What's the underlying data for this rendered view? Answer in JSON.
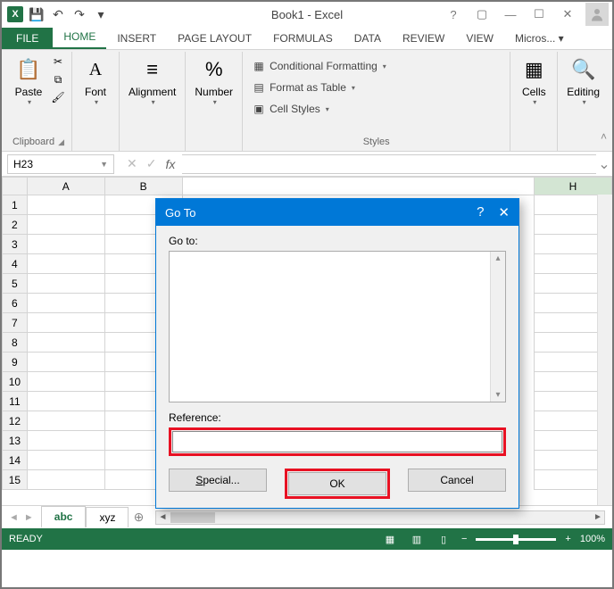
{
  "title": "Book1 - Excel",
  "qat": {
    "save": "💾",
    "undo": "↶",
    "redo": "↷"
  },
  "tabs": {
    "file": "FILE",
    "items": [
      "HOME",
      "INSERT",
      "PAGE LAYOUT",
      "FORMULAS",
      "DATA",
      "REVIEW",
      "VIEW"
    ],
    "last": "Micros..."
  },
  "ribbon": {
    "clipboard": {
      "label": "Clipboard",
      "paste": "Paste"
    },
    "font": {
      "label": "Font"
    },
    "alignment": {
      "label": "Alignment"
    },
    "number": {
      "label": "Number"
    },
    "styles": {
      "label": "Styles",
      "cond": "Conditional Formatting",
      "table": "Format as Table",
      "cell": "Cell Styles"
    },
    "cells": {
      "label": "Cells"
    },
    "editing": {
      "label": "Editing"
    }
  },
  "namebox": "H23",
  "columns": [
    "A",
    "B",
    "H"
  ],
  "rows": [
    "1",
    "2",
    "3",
    "4",
    "5",
    "6",
    "7",
    "8",
    "9",
    "10",
    "11",
    "12",
    "13",
    "14",
    "15"
  ],
  "sheets": {
    "active": "abc",
    "other": "xyz"
  },
  "dialog": {
    "title": "Go To",
    "goto_label": "Go to:",
    "ref_label": "Reference:",
    "ref_value": "",
    "special": "Special...",
    "ok": "OK",
    "cancel": "Cancel"
  },
  "status": {
    "ready": "READY",
    "zoom": "100%"
  }
}
